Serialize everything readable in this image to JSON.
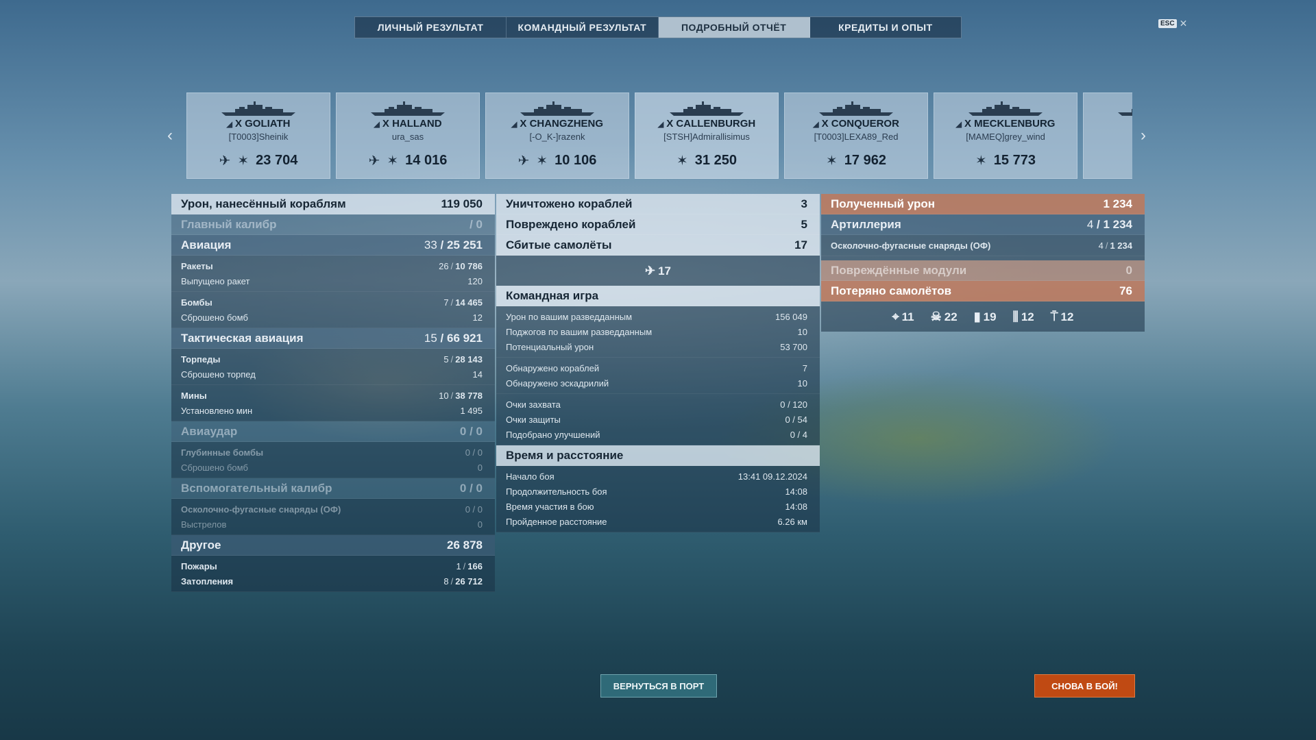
{
  "tabs": [
    "ЛИЧНЫЙ РЕЗУЛЬТАТ",
    "КОМАНДНЫЙ РЕЗУЛЬТАТ",
    "ПОДРОБНЫЙ ОТЧЁТ",
    "КРЕДИТЫ И ОПЫТ"
  ],
  "active_tab": "ПОДРОБНЫЙ ОТЧЁТ",
  "esc": {
    "key": "ESC",
    "close": "✕"
  },
  "nav": {
    "prev": "‹",
    "next": "›"
  },
  "ships": [
    {
      "name": "X GOLIATH",
      "player": "[T0003]Sheinik",
      "damage": "23 704",
      "plane_icon": true
    },
    {
      "name": "X HALLAND",
      "player": "ura_sas",
      "damage": "14 016",
      "plane_icon": true
    },
    {
      "name": "X CHANGZHENG",
      "player": "[-O_K-]razenk",
      "damage": "10 106",
      "plane_icon": true
    },
    {
      "name": "X CALLENBURGH",
      "player": "[STSH]Admirallisimus",
      "damage": "31 250",
      "plane_icon": false
    },
    {
      "name": "X CONQUEROR",
      "player": "[T0003]LEXA89_Red",
      "damage": "17 962",
      "plane_icon": false
    },
    {
      "name": "X MECKLENBURG",
      "player": "[MAMEQ]grey_wind",
      "damage": "15 773",
      "plane_icon": false
    }
  ],
  "col1": {
    "damage": {
      "label": "Урон, нанесённый кораблям",
      "value": "119 050"
    },
    "main": {
      "label": "Главный калибр",
      "value": "/ 0"
    },
    "aviation": {
      "label": "Авиация",
      "a": "33",
      "b": "25 251"
    },
    "rockets": {
      "label": "Ракеты",
      "a": "26",
      "b": "10 786"
    },
    "rockets_fired": {
      "label": "Выпущено ракет",
      "value": "120"
    },
    "bombs": {
      "label": "Бомбы",
      "a": "7",
      "b": "14 465"
    },
    "bombs_dropped": {
      "label": "Сброшено бомб",
      "value": "12"
    },
    "tactical": {
      "label": "Тактическая авиация",
      "a": "15",
      "b": "66 921"
    },
    "torpedoes": {
      "label": "Торпеды",
      "a": "5",
      "b": "28 143"
    },
    "torpedoes_dropped": {
      "label": "Сброшено торпед",
      "value": "14"
    },
    "mines": {
      "label": "Мины",
      "a": "10",
      "b": "38 778"
    },
    "mines_laid": {
      "label": "Установлено мин",
      "value": "1 495"
    },
    "airstrike": {
      "label": "Авиаудар",
      "value": "0 / 0"
    },
    "depth": {
      "label": "Глубинные бомбы",
      "value": "0 / 0"
    },
    "depth_dropped": {
      "label": "Сброшено бомб",
      "value": "0"
    },
    "secondary": {
      "label": "Вспомогательный калибр",
      "value": "0 / 0"
    },
    "he": {
      "label": "Осколочно-фугасные снаряды (ОФ)",
      "value": "0 / 0"
    },
    "shots": {
      "label": "Выстрелов",
      "value": "0"
    },
    "other": {
      "label": "Другое",
      "value": "26 878"
    },
    "fires": {
      "label": "Пожары",
      "a": "1",
      "b": "166"
    },
    "floods": {
      "label": "Затопления",
      "a": "8",
      "b": "26 712"
    }
  },
  "col2": {
    "destroyed": {
      "label": "Уничтожено кораблей",
      "value": "3"
    },
    "damaged": {
      "label": "Повреждено кораблей",
      "value": "5"
    },
    "planes": {
      "label": "Сбитые самолёты",
      "value": "17"
    },
    "planes_icon_value": "17",
    "team": {
      "label": "Командная игра"
    },
    "spot_dmg": {
      "label": "Урон по вашим разведданным",
      "value": "156 049"
    },
    "spot_fires": {
      "label": "Поджогов по вашим разведданным",
      "value": "10"
    },
    "potential": {
      "label": "Потенциальный урон",
      "value": "53 700"
    },
    "spotted_ships": {
      "label": "Обнаружено кораблей",
      "value": "7"
    },
    "spotted_sq": {
      "label": "Обнаружено эскадрилий",
      "value": "10"
    },
    "capture": {
      "label": "Очки захвата",
      "value": "0 / 120"
    },
    "defense": {
      "label": "Очки защиты",
      "value": "0 / 54"
    },
    "upgrades": {
      "label": "Подобрано улучшений",
      "value": "0 / 4"
    },
    "time": {
      "label": "Время и расстояние"
    },
    "start": {
      "label": "Начало боя",
      "value": "13:41  09.12.2024"
    },
    "duration": {
      "label": "Продолжительность боя",
      "value": "14:08"
    },
    "time_in": {
      "label": "Время участия в бою",
      "value": "14:08"
    },
    "distance": {
      "label": "Пройденное расстояние",
      "value": "6.26 км"
    }
  },
  "col3": {
    "received": {
      "label": "Полученный урон",
      "value": "1 234"
    },
    "artillery": {
      "label": "Артиллерия",
      "a": "4",
      "b": "1 234"
    },
    "he": {
      "label": "Осколочно-фугасные снаряды (ОФ)",
      "a": "4",
      "b": "1 234"
    },
    "modules": {
      "label": "Повреждённые модули",
      "value": "0"
    },
    "lost_planes": {
      "label": "Потеряно самолётов",
      "value": "76"
    },
    "icons": [
      {
        "icon": "crosshair-icon",
        "glyph": "⌖",
        "value": "11"
      },
      {
        "icon": "skull-icon",
        "glyph": "☠",
        "value": "22"
      },
      {
        "icon": "bomb-icon",
        "glyph": "▮",
        "value": "19"
      },
      {
        "icon": "rocket-icon",
        "glyph": "⫼",
        "value": "12"
      },
      {
        "icon": "mine-icon",
        "glyph": "⍑",
        "value": "12"
      }
    ]
  },
  "buttons": {
    "port": "ВЕРНУТЬСЯ В ПОРТ",
    "battle": "СНОВА В БОЙ!"
  },
  "colors": {
    "accent": "#c04a13",
    "port": "#2f6a78",
    "received": "#be785a"
  }
}
